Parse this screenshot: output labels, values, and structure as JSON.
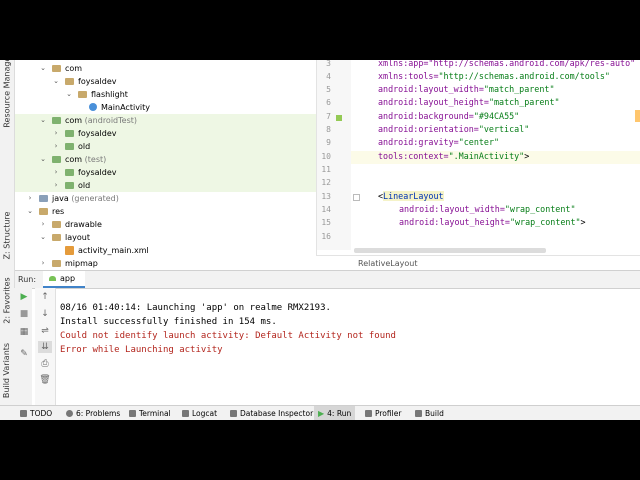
{
  "side_tabs": {
    "resource_manager": "Resource Manager",
    "structure": "Z: Structure",
    "favorites": "2: Favorites",
    "build_variants": "Build Variants"
  },
  "tree": [
    {
      "label": "com",
      "muted": ""
    },
    {
      "label": "foysaldev",
      "muted": ""
    },
    {
      "label": "flashlight",
      "muted": ""
    },
    {
      "label": "MainActivity",
      "muted": ""
    },
    {
      "label": "com",
      "muted": "(androidTest)"
    },
    {
      "label": "foysaldev",
      "muted": ""
    },
    {
      "label": "old",
      "muted": ""
    },
    {
      "label": "com",
      "muted": "(test)"
    },
    {
      "label": "foysaldev",
      "muted": ""
    },
    {
      "label": "old",
      "muted": ""
    },
    {
      "label": "java",
      "muted": "(generated)"
    },
    {
      "label": "res",
      "muted": ""
    },
    {
      "label": "drawable",
      "muted": ""
    },
    {
      "label": "layout",
      "muted": ""
    },
    {
      "label": "activity_main.xml",
      "muted": ""
    },
    {
      "label": "mipmap",
      "muted": ""
    }
  ],
  "editor": {
    "line_numbers": [
      "3",
      "4",
      "5",
      "6",
      "7",
      "8",
      "9",
      "10",
      "11",
      "12",
      "13",
      "14",
      "15",
      "16"
    ],
    "line3": "xmlns:app=\"http://schemas.android.com/apk/res-auto\"",
    "line4_attr": "xmlns:tools=",
    "line4_val": "\"http://schemas.android.com/tools\"",
    "line5_attr": "android:layout_width=",
    "line5_val": "\"match_parent\"",
    "line6_attr": "android:layout_height=",
    "line6_val": "\"match_parent\"",
    "line7_attr": "android:background=",
    "line7_val": "\"#94CA55\"",
    "line8_attr": "android:orientation=",
    "line8_val": "\"vertical\"",
    "line9_attr": "android:gravity=",
    "line9_val": "\"center\"",
    "line10_attr": "tools:context=",
    "line10_val": "\".MainActivity\"",
    "line10_end": ">",
    "line13_open": "<",
    "line13_tag": "LinearLayout",
    "line14_attr": "android:layout_width=",
    "line14_val": "\"wrap_content\"",
    "line15_attr": "android:layout_height=",
    "line15_val": "\"wrap_content\"",
    "line15_end": ">",
    "breadcrumb": "RelativeLayout",
    "swatch_color": "#94CA55"
  },
  "run": {
    "label": "Run:",
    "tab": "app",
    "lines": [
      {
        "text": "08/16 01:40:14: Launching 'app' on realme RMX2193.",
        "color": "#000000"
      },
      {
        "text": "Install successfully finished in 154 ms.",
        "color": "#000000"
      },
      {
        "text": "Could not identify launch activity: Default Activity not found",
        "color": "#b3261e"
      },
      {
        "text": "Error while Launching activity",
        "color": "#b3261e"
      }
    ]
  },
  "statusbar": {
    "todo": "TODO",
    "problems": "6: Problems",
    "terminal": "Terminal",
    "logcat": "Logcat",
    "database": "Database Inspector",
    "run": "4: Run",
    "profiler": "Profiler",
    "build": "Build"
  }
}
